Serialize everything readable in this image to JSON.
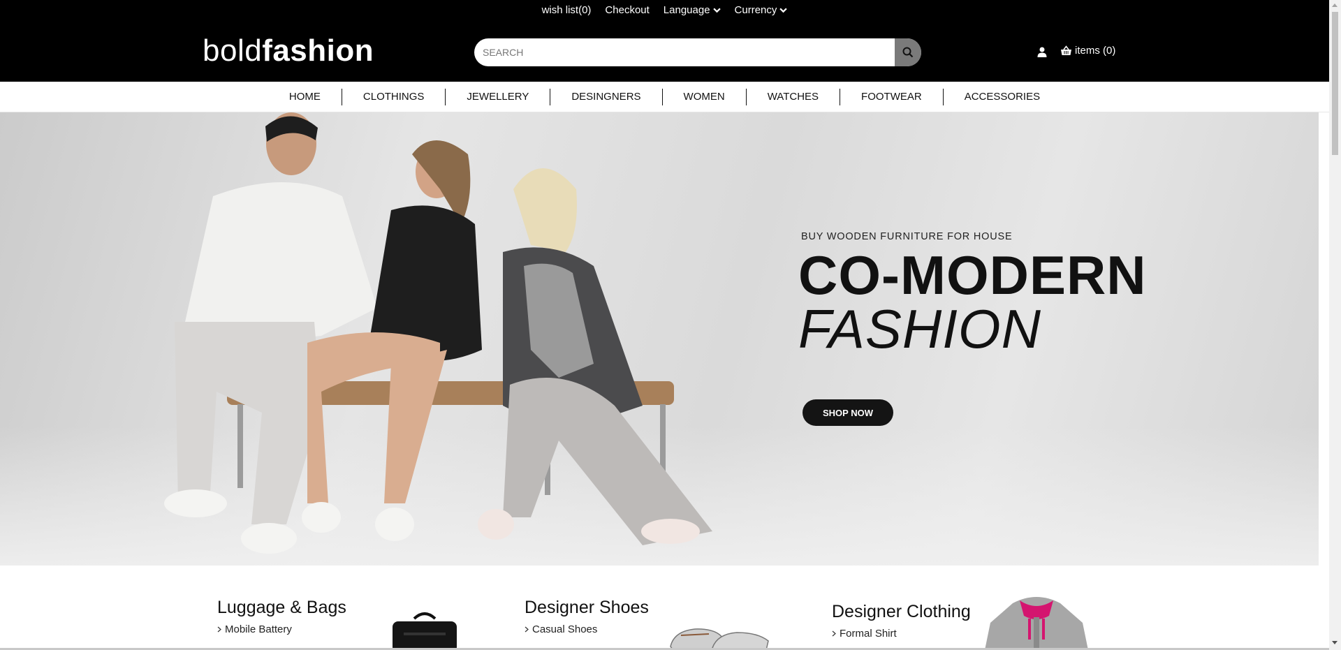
{
  "topbar": {
    "wishlist": "wish list(0)",
    "checkout": "Checkout",
    "language": "Language",
    "currency": "Currency"
  },
  "brand": {
    "light": "bold",
    "bold": "fashion"
  },
  "search": {
    "placeholder": "SEARCH"
  },
  "cart": {
    "label": "items (0)"
  },
  "nav": [
    "HOME",
    "CLOTHINGS",
    "JEWELLERY",
    "DESINGNERS",
    "WOMEN",
    "WATCHES",
    "FOOTWEAR",
    "ACCESSORIES"
  ],
  "hero": {
    "subtitle": "BUY WOODEN FURNITURE FOR HOUSE",
    "title_line1": "CO-MODERN",
    "title_line2": "FASHION",
    "button": "SHOP NOW"
  },
  "categories": [
    {
      "title": "Luggage & Bags",
      "link": "Mobile Battery"
    },
    {
      "title": "Designer Shoes",
      "link": "Casual Shoes"
    },
    {
      "title": "Designer Clothing",
      "link": "Formal Shirt"
    }
  ],
  "icons": {
    "search": "search-icon",
    "user": "user-icon",
    "cart": "basket-icon",
    "dropdown": "chevron-down-icon",
    "link_arrow": "chevron-right-icon"
  },
  "colors": {
    "header_bg": "#000000",
    "button_bg": "#141414",
    "accent_pink": "#d4156f"
  }
}
